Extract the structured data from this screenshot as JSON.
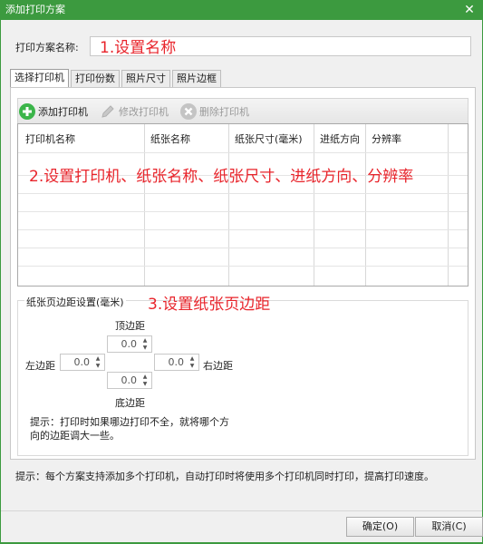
{
  "window": {
    "title": "添加打印方案",
    "close": "✕"
  },
  "name_field": {
    "label": "打印方案名称:",
    "value": ""
  },
  "annotations": {
    "a1": "1.设置名称",
    "a2": "2.设置打印机、纸张名称、纸张尺寸、进纸方向、分辨率",
    "a3": "3.设置纸张页边距"
  },
  "tabs": [
    {
      "label": "选择打印机"
    },
    {
      "label": "打印份数"
    },
    {
      "label": "照片尺寸"
    },
    {
      "label": "照片边框"
    }
  ],
  "toolbar": {
    "add": "添加打印机",
    "edit": "修改打印机",
    "delete": "删除打印机"
  },
  "grid": {
    "columns": [
      "打印机名称",
      "纸张名称",
      "纸张尺寸(毫米)",
      "进纸方向",
      "分辨率"
    ]
  },
  "margins": {
    "title": "纸张页边距设置(毫米)",
    "top_label": "顶边距",
    "left_label": "左边距",
    "right_label": "右边距",
    "bottom_label": "底边距",
    "top_value": "0.0",
    "left_value": "0.0",
    "right_value": "0.0",
    "bottom_value": "0.0",
    "tip": "提示：打印时如果哪边打印不全，就将哪个方向的边距调大一些。"
  },
  "bottom_tip": "提示：每个方案支持添加多个打印机，自动打印时将使用多个打印机同时打印，提高打印速度。",
  "buttons": {
    "ok": "确定(O)",
    "cancel": "取消(C)"
  },
  "colors": {
    "titlebar": "#3c9a3f",
    "annotation": "#e8242b",
    "add_icon": "#3bb54a"
  }
}
